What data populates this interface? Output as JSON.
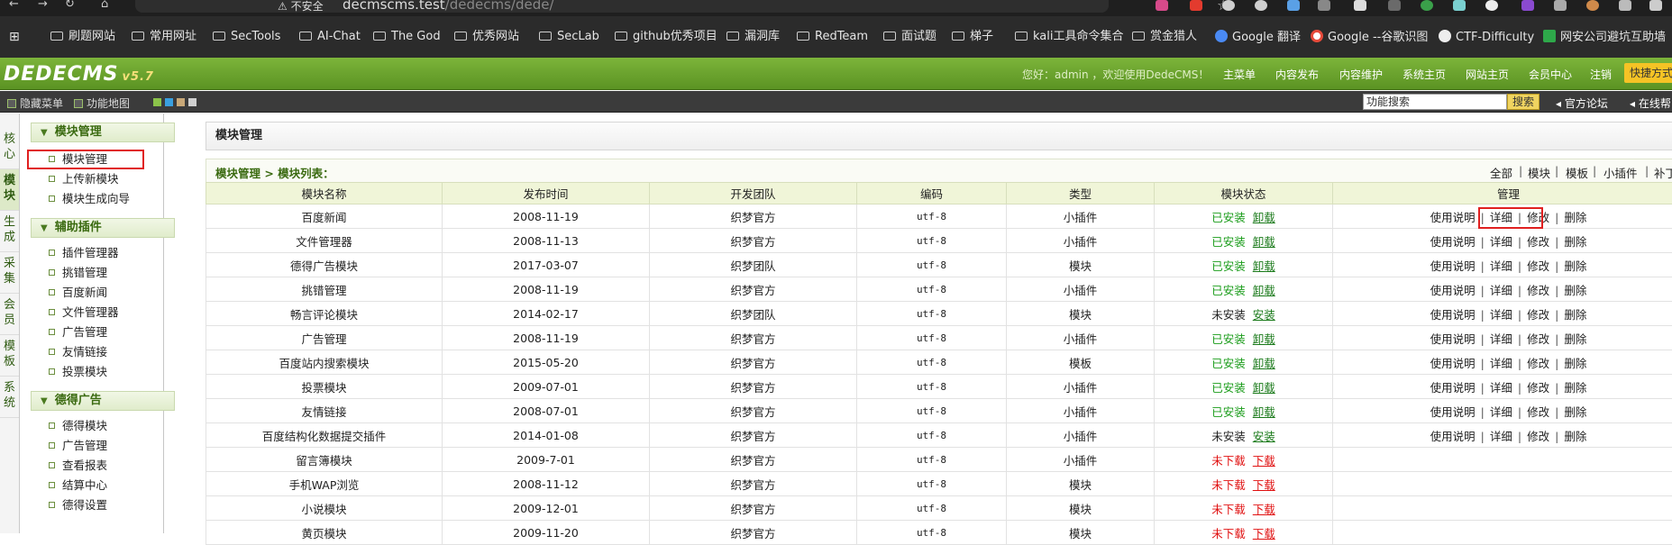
{
  "browser": {
    "security": "不安全",
    "url_host": "decmscms.test",
    "url_path": "/dedecms/dede/",
    "bookmarks": [
      "刷题网站",
      "常用网址",
      "SecTools",
      "AI-Chat",
      "The God",
      "优秀网站",
      "SecLab",
      "github优秀项目",
      "漏洞库",
      "RedTeam",
      "面试题",
      "梯子",
      "kali工具命令集合",
      "赏金猎人",
      "Google 翻译",
      "Google --谷歌识图",
      "CTF-Difficulty",
      "网安公司避坑互助墙"
    ]
  },
  "header": {
    "logo": "DEDECMS",
    "version": "v5.7",
    "welcome": "您好：admin ，欢迎使用DedeCMS！",
    "links": [
      "主菜单",
      "内容发布",
      "内容维护",
      "系统主页",
      "网站主页",
      "会员中心",
      "注销"
    ],
    "quick": "快捷方式"
  },
  "subbar": {
    "hide_menu": "隐藏菜单",
    "site_map": "功能地图",
    "search_value": "功能搜索",
    "search_btn": "搜索",
    "forum": "官方论坛",
    "online": "在线帮"
  },
  "vtabs": [
    "核心",
    "模块",
    "生成",
    "采集",
    "会员",
    "模板",
    "系统"
  ],
  "menu": [
    {
      "title": "模块管理",
      "items": [
        "模块管理",
        "上传新模块",
        "模块生成向导"
      ]
    },
    {
      "title": "辅助插件",
      "items": [
        "插件管理器",
        "挑错管理",
        "百度新闻",
        "文件管理器",
        "广告管理",
        "友情链接",
        "投票模块"
      ]
    },
    {
      "title": "德得广告",
      "items": [
        "德得模块",
        "广告管理",
        "查看报表",
        "结算中心",
        "德得设置"
      ]
    }
  ],
  "page": {
    "title": "模块管理",
    "crumb": "模块管理 > 模块列表：",
    "filters": [
      "全部",
      "模块",
      "模板",
      "小插件",
      "补丁"
    ]
  },
  "table": {
    "headers": [
      "模块名称",
      "发布时间",
      "开发团队",
      "编码",
      "类型",
      "模块状态",
      "管理"
    ],
    "rows": [
      {
        "name": "百度新闻",
        "date": "2008-11-19",
        "team": "织梦官方",
        "enc": "utf-8",
        "type": "小插件",
        "status": "已安装",
        "action": "卸载",
        "kind": "ok"
      },
      {
        "name": "文件管理器",
        "date": "2008-11-13",
        "team": "织梦官方",
        "enc": "utf-8",
        "type": "小插件",
        "status": "已安装",
        "action": "卸载",
        "kind": "ok"
      },
      {
        "name": "德得广告模块",
        "date": "2017-03-07",
        "team": "织梦团队",
        "enc": "utf-8",
        "type": "模块",
        "status": "已安装",
        "action": "卸载",
        "kind": "ok"
      },
      {
        "name": "挑错管理",
        "date": "2008-11-19",
        "team": "织梦官方",
        "enc": "utf-8",
        "type": "小插件",
        "status": "已安装",
        "action": "卸载",
        "kind": "ok"
      },
      {
        "name": "畅言评论模块",
        "date": "2014-02-17",
        "team": "织梦团队",
        "enc": "utf-8",
        "type": "模块",
        "status": "未安装",
        "action": "安装",
        "kind": "off"
      },
      {
        "name": "广告管理",
        "date": "2008-11-19",
        "team": "织梦官方",
        "enc": "utf-8",
        "type": "小插件",
        "status": "已安装",
        "action": "卸载",
        "kind": "ok"
      },
      {
        "name": "百度站内搜索模块",
        "date": "2015-05-20",
        "team": "织梦官方",
        "enc": "utf-8",
        "type": "模板",
        "status": "已安装",
        "action": "卸载",
        "kind": "ok"
      },
      {
        "name": "投票模块",
        "date": "2009-07-01",
        "team": "织梦官方",
        "enc": "utf-8",
        "type": "小插件",
        "status": "已安装",
        "action": "卸载",
        "kind": "ok"
      },
      {
        "name": "友情链接",
        "date": "2008-07-01",
        "team": "织梦官方",
        "enc": "utf-8",
        "type": "小插件",
        "status": "已安装",
        "action": "卸载",
        "kind": "ok"
      },
      {
        "name": "百度结构化数据提交插件",
        "date": "2014-01-08",
        "team": "织梦官方",
        "enc": "utf-8",
        "type": "小插件",
        "status": "未安装",
        "action": "安装",
        "kind": "off"
      },
      {
        "name": "留言簿模块",
        "date": "2009-7-01",
        "team": "织梦官方",
        "enc": "utf-8",
        "type": "小插件",
        "status": "未下载",
        "action": "下载",
        "kind": "none"
      },
      {
        "name": "手机WAP浏览",
        "date": "2008-11-12",
        "team": "织梦官方",
        "enc": "utf-8",
        "type": "模块",
        "status": "未下载",
        "action": "下载",
        "kind": "none"
      },
      {
        "name": "小说模块",
        "date": "2009-12-01",
        "team": "织梦官方",
        "enc": "utf-8",
        "type": "模块",
        "status": "未下载",
        "action": "下载",
        "kind": "none"
      },
      {
        "name": "黄页模块",
        "date": "2009-11-20",
        "team": "织梦官方",
        "enc": "utf-8",
        "type": "模块",
        "status": "未下载",
        "action": "下载",
        "kind": "none"
      }
    ],
    "manage": [
      "使用说明",
      "详细",
      "修改",
      "删除"
    ]
  },
  "colors": {
    "accent": "#5b9323",
    "installed": "#1a9c1a",
    "missing": "#e01010",
    "highlight": "#e02020"
  }
}
